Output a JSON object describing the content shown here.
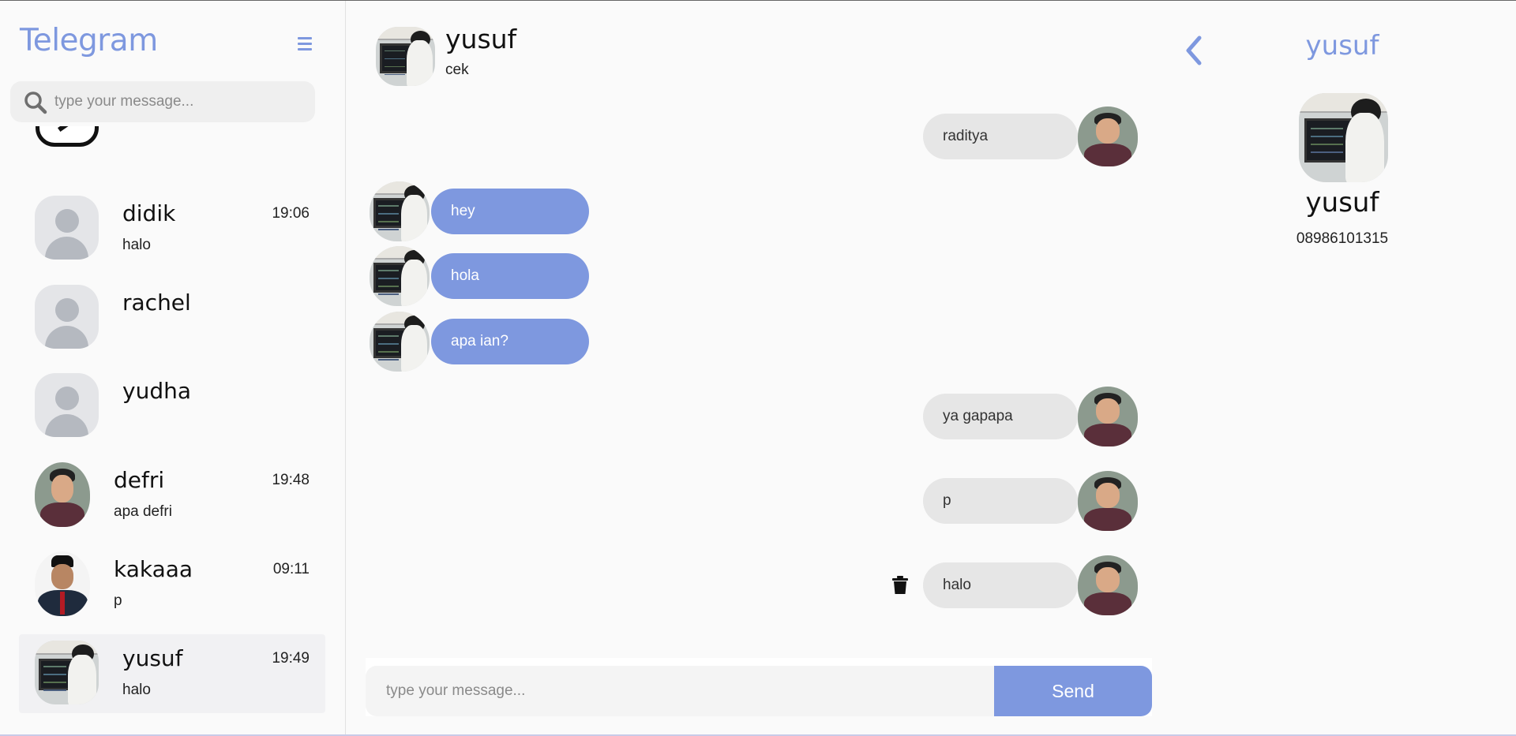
{
  "app": {
    "title": "Telegram"
  },
  "sidebar": {
    "search_placeholder": "type your message...",
    "contacts": [
      {
        "name": "didik",
        "time": "19:06",
        "last_message": "halo",
        "avatar": "default-avatar"
      },
      {
        "name": "rachel",
        "time": "",
        "last_message": "",
        "avatar": "default-avatar"
      },
      {
        "name": "yudha",
        "time": "",
        "last_message": "",
        "avatar": "default-avatar"
      },
      {
        "name": "defri",
        "time": "19:48",
        "last_message": "apa defri",
        "avatar": "photo"
      },
      {
        "name": "kakaaa",
        "time": "09:11",
        "last_message": "p",
        "avatar": "photo"
      },
      {
        "name": "yusuf",
        "time": "19:49",
        "last_message": "halo",
        "avatar": "photo",
        "active": true
      }
    ]
  },
  "chat": {
    "header": {
      "name": "yusuf",
      "status": "cek"
    },
    "messages": [
      {
        "direction": "out",
        "text": "raditya"
      },
      {
        "direction": "in",
        "text": "hey"
      },
      {
        "direction": "in",
        "text": "hola"
      },
      {
        "direction": "in",
        "text": "apa ian?"
      },
      {
        "direction": "out",
        "text": "ya gapapa"
      },
      {
        "direction": "out",
        "text": "p"
      },
      {
        "direction": "out",
        "text": "halo",
        "deletable": true
      }
    ],
    "composer": {
      "placeholder": "type your message...",
      "send_label": "Send"
    }
  },
  "profile": {
    "title": "yusuf",
    "name": "yusuf",
    "phone": "08986101315"
  },
  "colors": {
    "accent": "#7e98df",
    "incoming_bubble": "#7e98df",
    "outgoing_bubble": "#e6e6e6",
    "background": "#fafafa"
  },
  "icons": [
    "menu-icon",
    "search-icon",
    "trash-icon",
    "back-chevron-icon"
  ]
}
